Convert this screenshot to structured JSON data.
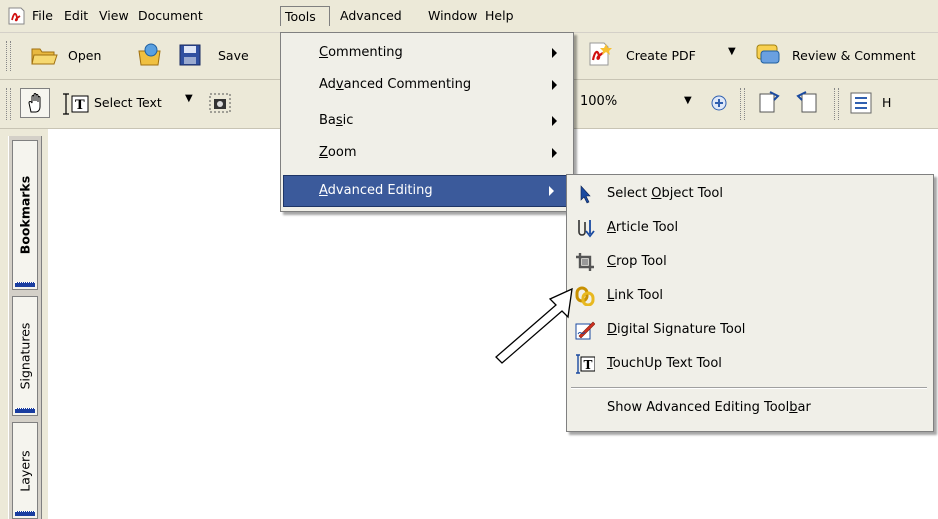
{
  "menubar": {
    "items": [
      "File",
      "Edit",
      "View",
      "Document",
      "Tools",
      "Advanced",
      "Window",
      "Help"
    ]
  },
  "toolbar1": {
    "open": "Open",
    "save": "Save",
    "create_pdf": "Create PDF",
    "review_comment": "Review & Comment"
  },
  "toolbar2": {
    "select_text": "Select Text",
    "zoom": "100%",
    "cut_label": "H"
  },
  "side_tabs": [
    "Bookmarks",
    "Signatures",
    "Layers"
  ],
  "tools_menu": {
    "items": [
      {
        "label": "Commenting",
        "underline": "C"
      },
      {
        "label": "Advanced Commenting",
        "underline": "v"
      },
      {
        "label": "Basic",
        "underline": "s"
      },
      {
        "label": "Zoom",
        "underline": "Z"
      },
      {
        "label": "Advanced Editing",
        "underline": "A"
      }
    ]
  },
  "advanced_editing_menu": {
    "items": [
      {
        "label": "Select Object Tool",
        "icon": "arrow-pointer-icon"
      },
      {
        "label": "Article Tool",
        "icon": "article-icon"
      },
      {
        "label": "Crop Tool",
        "icon": "crop-icon"
      },
      {
        "label": "Link Tool",
        "icon": "link-icon"
      },
      {
        "label": "Digital Signature Tool",
        "icon": "signature-pen-icon"
      },
      {
        "label": "TouchUp Text Tool",
        "icon": "touchup-text-icon"
      }
    ],
    "footer": "Show Advanced Editing Toolbar"
  },
  "colors": {
    "highlight": "#3b5a9b",
    "chrome": "#ece9d8"
  }
}
